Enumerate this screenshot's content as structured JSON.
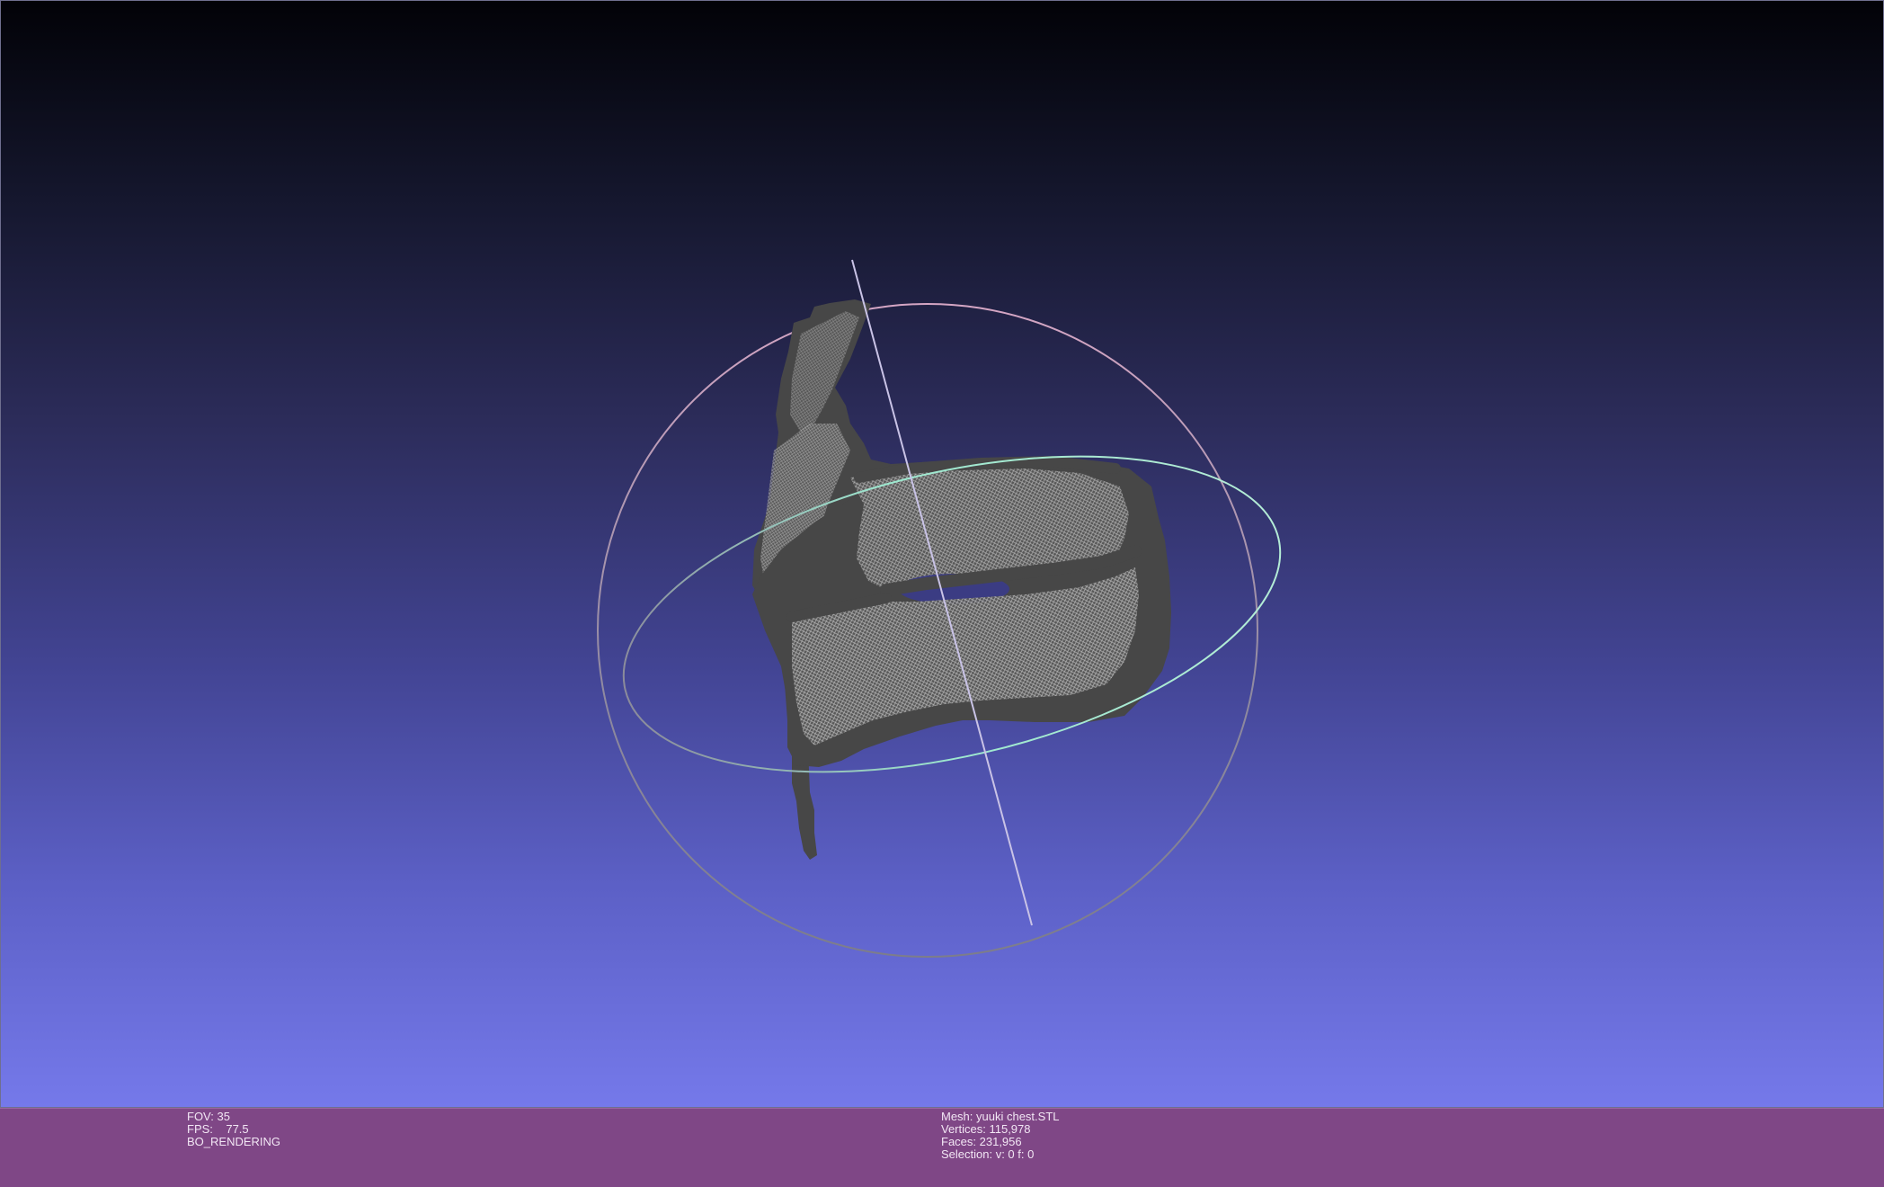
{
  "viewport": {
    "background_top": "#020207",
    "background_bottom": "#7579ea",
    "mesh_color": "#474747",
    "wire_color": "#b5b5b5",
    "trackball_horizontal_color": "#8fe6c8",
    "trackball_vertical_color": "#d8a8c4"
  },
  "info_left": {
    "fov": "FOV: 35",
    "fps": "FPS:    77.5",
    "mode": "BO_RENDERING"
  },
  "info_right": {
    "mesh": "Mesh: yuuki chest.STL",
    "vertices": "Vertices: 115,978",
    "faces": "Faces: 231,956",
    "selection": "Selection: v: 0 f: 0"
  },
  "infobar": {
    "color": "#7f4786"
  }
}
